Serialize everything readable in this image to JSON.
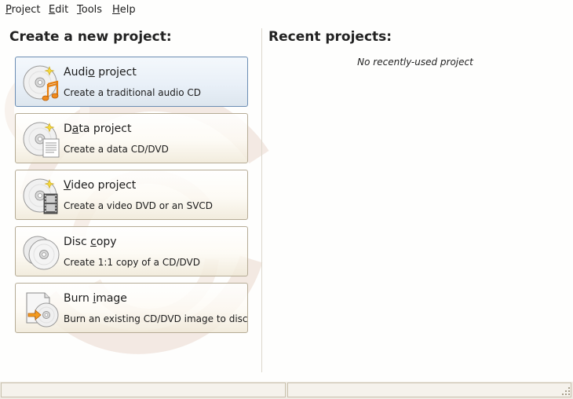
{
  "menubar": {
    "items": [
      {
        "mnemonic": "P",
        "rest": "roject"
      },
      {
        "mnemonic": "E",
        "rest": "dit"
      },
      {
        "mnemonic": "T",
        "rest": "ools"
      },
      {
        "mnemonic": "H",
        "rest": "elp"
      }
    ]
  },
  "create": {
    "heading": "Create a new project:",
    "projects": [
      {
        "title_pre": "Audi",
        "title_ul": "o",
        "title_post": " project",
        "description": "Create a traditional audio CD",
        "icon": "audio-disc-icon"
      },
      {
        "title_pre": "D",
        "title_ul": "a",
        "title_post": "ta project",
        "description": "Create a data CD/DVD",
        "icon": "data-disc-icon"
      },
      {
        "title_pre": "",
        "title_ul": "V",
        "title_post": "ideo project",
        "description": "Create a video DVD or an SVCD",
        "icon": "video-disc-icon"
      },
      {
        "title_pre": "Disc ",
        "title_ul": "c",
        "title_post": "opy",
        "description": "Create 1:1 copy of a CD/DVD",
        "icon": "disc-copy-icon"
      },
      {
        "title_pre": "Burn ",
        "title_ul": "i",
        "title_post": "mage",
        "description": "Burn an existing CD/DVD image to disc",
        "icon": "burn-image-icon"
      }
    ]
  },
  "recent": {
    "heading": "Recent projects:",
    "empty_message": "No recently-used project"
  },
  "status": {
    "left": "",
    "right": ""
  },
  "colors": {
    "selected_border": "#6b8db3",
    "button_border": "#b5ab95",
    "accent_orange": "#f08a1c",
    "star_yellow": "#f5d93a"
  }
}
